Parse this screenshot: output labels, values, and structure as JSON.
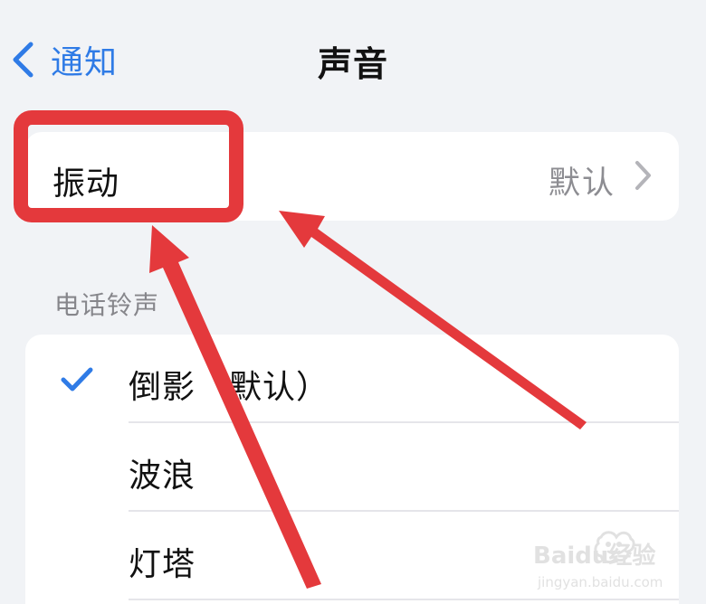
{
  "nav": {
    "back_label": "通知",
    "title": "声音"
  },
  "vibration_row": {
    "label": "振动",
    "value": "默认"
  },
  "ringtones": {
    "section_title": "电话铃声",
    "items": [
      {
        "label": "倒影（默认）",
        "selected": true
      },
      {
        "label": "波浪",
        "selected": false
      },
      {
        "label": "灯塔",
        "selected": false
      }
    ]
  },
  "watermark": {
    "brand": "Baidu经验",
    "url": "jingyan.baidu.com"
  },
  "colors": {
    "accent_blue": "#2f7be6",
    "annotation_red": "#e4393c",
    "background": "#f1f3f6",
    "card": "#ffffff",
    "secondary_text": "#8d8d92"
  }
}
